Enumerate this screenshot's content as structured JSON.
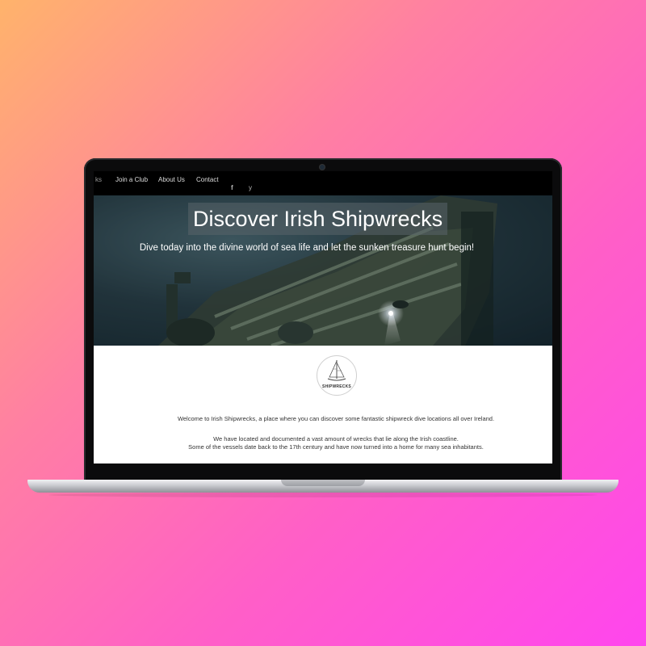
{
  "nav": {
    "logo_fragment": "ks",
    "items": [
      "Join a Club",
      "About Us",
      "Contact"
    ],
    "social": {
      "facebook": "f",
      "twitter": "y"
    }
  },
  "hero": {
    "title": "Discover Irish Shipwrecks",
    "subtitle": "Dive today into the divine world of sea life and let the sunken treasure hunt begin!"
  },
  "logo": {
    "text": "SHIPWRECKS"
  },
  "content": {
    "intro": "Welcome to Irish Shipwrecks, a place where you can discover some fantastic shipwreck dive locations all over Ireland.",
    "detail_line1": "We have located and documented a vast amount of wrecks that lie along the Irish coastline.",
    "detail_line2": "Some of the vessels date back to the 17th century and have now turned into a home for many sea inhabitants."
  },
  "colors": {
    "background_start": "#ffb36b",
    "background_end": "#ff45ee",
    "navbar": "#000000"
  }
}
